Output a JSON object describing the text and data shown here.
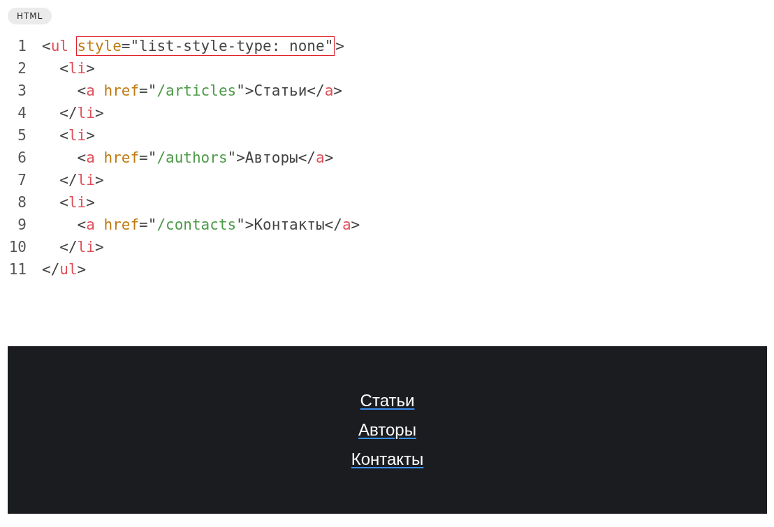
{
  "language_badge": "HTML",
  "code_lines": [
    {
      "number": "1",
      "tokens": [
        {
          "kind": "punct",
          "text": "<"
        },
        {
          "kind": "tag",
          "text": "ul "
        },
        {
          "kind": "highlight",
          "tokens": [
            {
              "kind": "attr",
              "text": "style"
            },
            {
              "kind": "punct",
              "text": "=\""
            },
            {
              "kind": "value",
              "text": "list-style-type: none"
            },
            {
              "kind": "punct",
              "text": "\""
            }
          ]
        },
        {
          "kind": "punct",
          "text": ">"
        }
      ]
    },
    {
      "number": "2",
      "tokens": [
        {
          "kind": "punct",
          "text": "  <"
        },
        {
          "kind": "tag",
          "text": "li"
        },
        {
          "kind": "punct",
          "text": ">"
        }
      ]
    },
    {
      "number": "3",
      "tokens": [
        {
          "kind": "punct",
          "text": "    <"
        },
        {
          "kind": "tag",
          "text": "a "
        },
        {
          "kind": "attr",
          "text": "href"
        },
        {
          "kind": "punct",
          "text": "=\""
        },
        {
          "kind": "string",
          "text": "/articles"
        },
        {
          "kind": "punct",
          "text": "\">Статьи</"
        },
        {
          "kind": "tag",
          "text": "a"
        },
        {
          "kind": "punct",
          "text": ">"
        }
      ]
    },
    {
      "number": "4",
      "tokens": [
        {
          "kind": "punct",
          "text": "  </"
        },
        {
          "kind": "tag",
          "text": "li"
        },
        {
          "kind": "punct",
          "text": ">"
        }
      ]
    },
    {
      "number": "5",
      "tokens": [
        {
          "kind": "punct",
          "text": "  <"
        },
        {
          "kind": "tag",
          "text": "li"
        },
        {
          "kind": "punct",
          "text": ">"
        }
      ]
    },
    {
      "number": "6",
      "tokens": [
        {
          "kind": "punct",
          "text": "    <"
        },
        {
          "kind": "tag",
          "text": "a "
        },
        {
          "kind": "attr",
          "text": "href"
        },
        {
          "kind": "punct",
          "text": "=\""
        },
        {
          "kind": "string",
          "text": "/authors"
        },
        {
          "kind": "punct",
          "text": "\">Авторы</"
        },
        {
          "kind": "tag",
          "text": "a"
        },
        {
          "kind": "punct",
          "text": ">"
        }
      ]
    },
    {
      "number": "7",
      "tokens": [
        {
          "kind": "punct",
          "text": "  </"
        },
        {
          "kind": "tag",
          "text": "li"
        },
        {
          "kind": "punct",
          "text": ">"
        }
      ]
    },
    {
      "number": "8",
      "tokens": [
        {
          "kind": "punct",
          "text": "  <"
        },
        {
          "kind": "tag",
          "text": "li"
        },
        {
          "kind": "punct",
          "text": ">"
        }
      ]
    },
    {
      "number": "9",
      "tokens": [
        {
          "kind": "punct",
          "text": "    <"
        },
        {
          "kind": "tag",
          "text": "a "
        },
        {
          "kind": "attr",
          "text": "href"
        },
        {
          "kind": "punct",
          "text": "=\""
        },
        {
          "kind": "string",
          "text": "/contacts"
        },
        {
          "kind": "punct",
          "text": "\">Контакты</"
        },
        {
          "kind": "tag",
          "text": "a"
        },
        {
          "kind": "punct",
          "text": ">"
        }
      ]
    },
    {
      "number": "10",
      "tokens": [
        {
          "kind": "punct",
          "text": "  </"
        },
        {
          "kind": "tag",
          "text": "li"
        },
        {
          "kind": "punct",
          "text": ">"
        }
      ]
    },
    {
      "number": "11",
      "tokens": [
        {
          "kind": "punct",
          "text": "</"
        },
        {
          "kind": "tag",
          "text": "ul"
        },
        {
          "kind": "punct",
          "text": ">"
        }
      ]
    }
  ],
  "preview_links": [
    "Статьи",
    "Авторы",
    "Контакты"
  ]
}
